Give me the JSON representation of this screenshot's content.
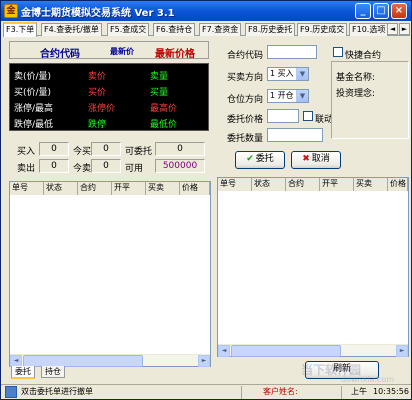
{
  "window": {
    "title": "金博士期货模拟交易系统 Ver 3.1",
    "icon_glyph": "金",
    "controls": [
      "_",
      "□",
      "×"
    ]
  },
  "tabs": [
    {
      "label": "F3.下单",
      "active": true
    },
    {
      "label": "F4.查委托/撤单"
    },
    {
      "label": "F5.查成交"
    },
    {
      "label": "F6.查持仓"
    },
    {
      "label": "F7.查资金"
    },
    {
      "label": "F8.历史委托"
    },
    {
      "label": "F9.历史成交"
    },
    {
      "label": "F10.选项"
    }
  ],
  "tab_scroll": [
    "◄",
    "►"
  ],
  "quote": {
    "header_code": "合约代码",
    "header_latest_small": "最新价",
    "header_latest": "最新价格",
    "rows": [
      {
        "label": "卖(价/量)",
        "v1": "卖价",
        "v2": "卖量"
      },
      {
        "label": "买(价/量)",
        "v1": "买价",
        "v2": "买量"
      },
      {
        "label": "涨停/最高",
        "v1": "涨停价",
        "v2": "最高价"
      },
      {
        "label": "跌停/最低",
        "v1": "跌停",
        "v2": "最低价"
      }
    ]
  },
  "account": {
    "buy_label": "买入",
    "buy_value": "0",
    "today_buy_label": "今买",
    "today_buy_value": "0",
    "can_order_label": "可委托",
    "can_order_value": "0",
    "sell_label": "卖出",
    "sell_value": "0",
    "today_sell_label": "今卖",
    "today_sell_value": "0",
    "available_label": "可用",
    "available_value": "500000"
  },
  "order_form": {
    "code_label": "合约代码",
    "quick_label": "快捷合约",
    "direction_label": "买卖方向",
    "direction_value": "1 买入",
    "offset_label": "仓位方向",
    "offset_value": "1 开仓",
    "price_label": "委托价格",
    "linked_label": "联动",
    "qty_label": "委托数量",
    "submit_label": "委托",
    "cancel_label": "取消"
  },
  "fund_info": {
    "name_label": "基金名称:",
    "idea_label": "投资理念:"
  },
  "left_grid": {
    "columns": [
      "单号",
      "状态",
      "合约",
      "开平",
      "买卖",
      "价格"
    ]
  },
  "right_grid": {
    "columns": [
      "单号",
      "状态",
      "合约",
      "开平",
      "买卖",
      "价格"
    ]
  },
  "bottom_tabs": [
    {
      "label": "委托",
      "active": true
    },
    {
      "label": "持仓"
    }
  ],
  "refresh_label": "刷新",
  "status": {
    "hint": "双击委托单进行撤单",
    "customer": "客户姓名:",
    "session": "上午",
    "time": "10:35:56"
  },
  "watermark": {
    "line1": "当下软件园",
    "line2": "downxia.com"
  },
  "colors": {
    "title_blue": "#0a56d8",
    "quote_red": "#ff4040",
    "quote_green": "#20ff20",
    "header_red": "#c00000",
    "available_purple": "#800080"
  }
}
